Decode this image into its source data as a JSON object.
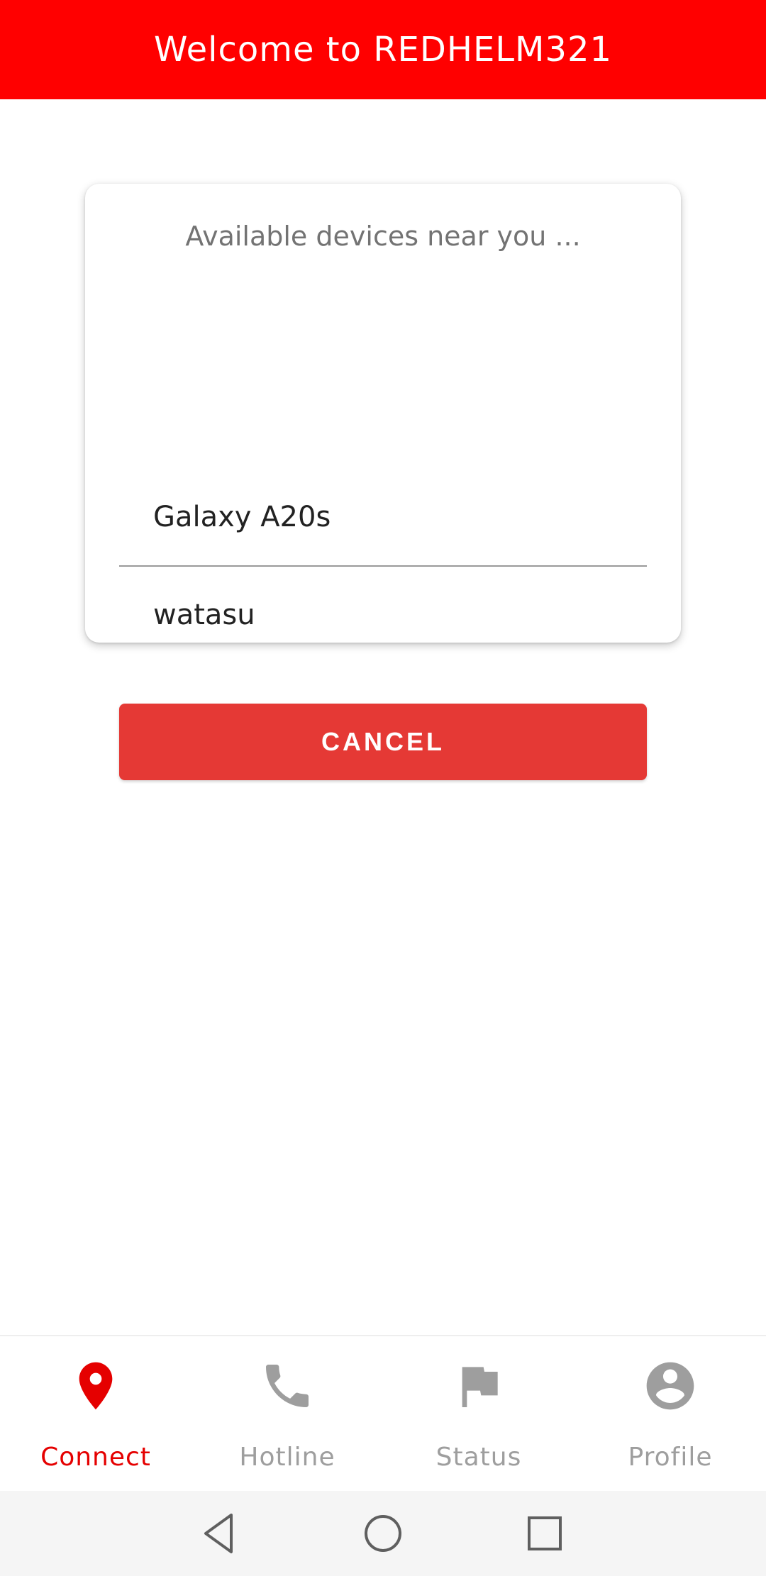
{
  "header": {
    "title": "Welcome to REDHELM321"
  },
  "dialog": {
    "title": "Available devices near you ...",
    "devices": [
      {
        "name": "Galaxy A20s"
      },
      {
        "name": "watasu"
      }
    ],
    "cancel_label": "CANCEL"
  },
  "bottom_nav": {
    "items": [
      {
        "label": "Connect",
        "icon": "map-pin-icon",
        "active": true
      },
      {
        "label": "Hotline",
        "icon": "phone-icon",
        "active": false
      },
      {
        "label": "Status",
        "icon": "flag-icon",
        "active": false
      },
      {
        "label": "Profile",
        "icon": "account-circle-icon",
        "active": false
      }
    ]
  },
  "colors": {
    "brand": "#ff0000",
    "button": "#e53935",
    "active_nav": "#e50000",
    "inactive_nav": "#9e9e9e"
  }
}
